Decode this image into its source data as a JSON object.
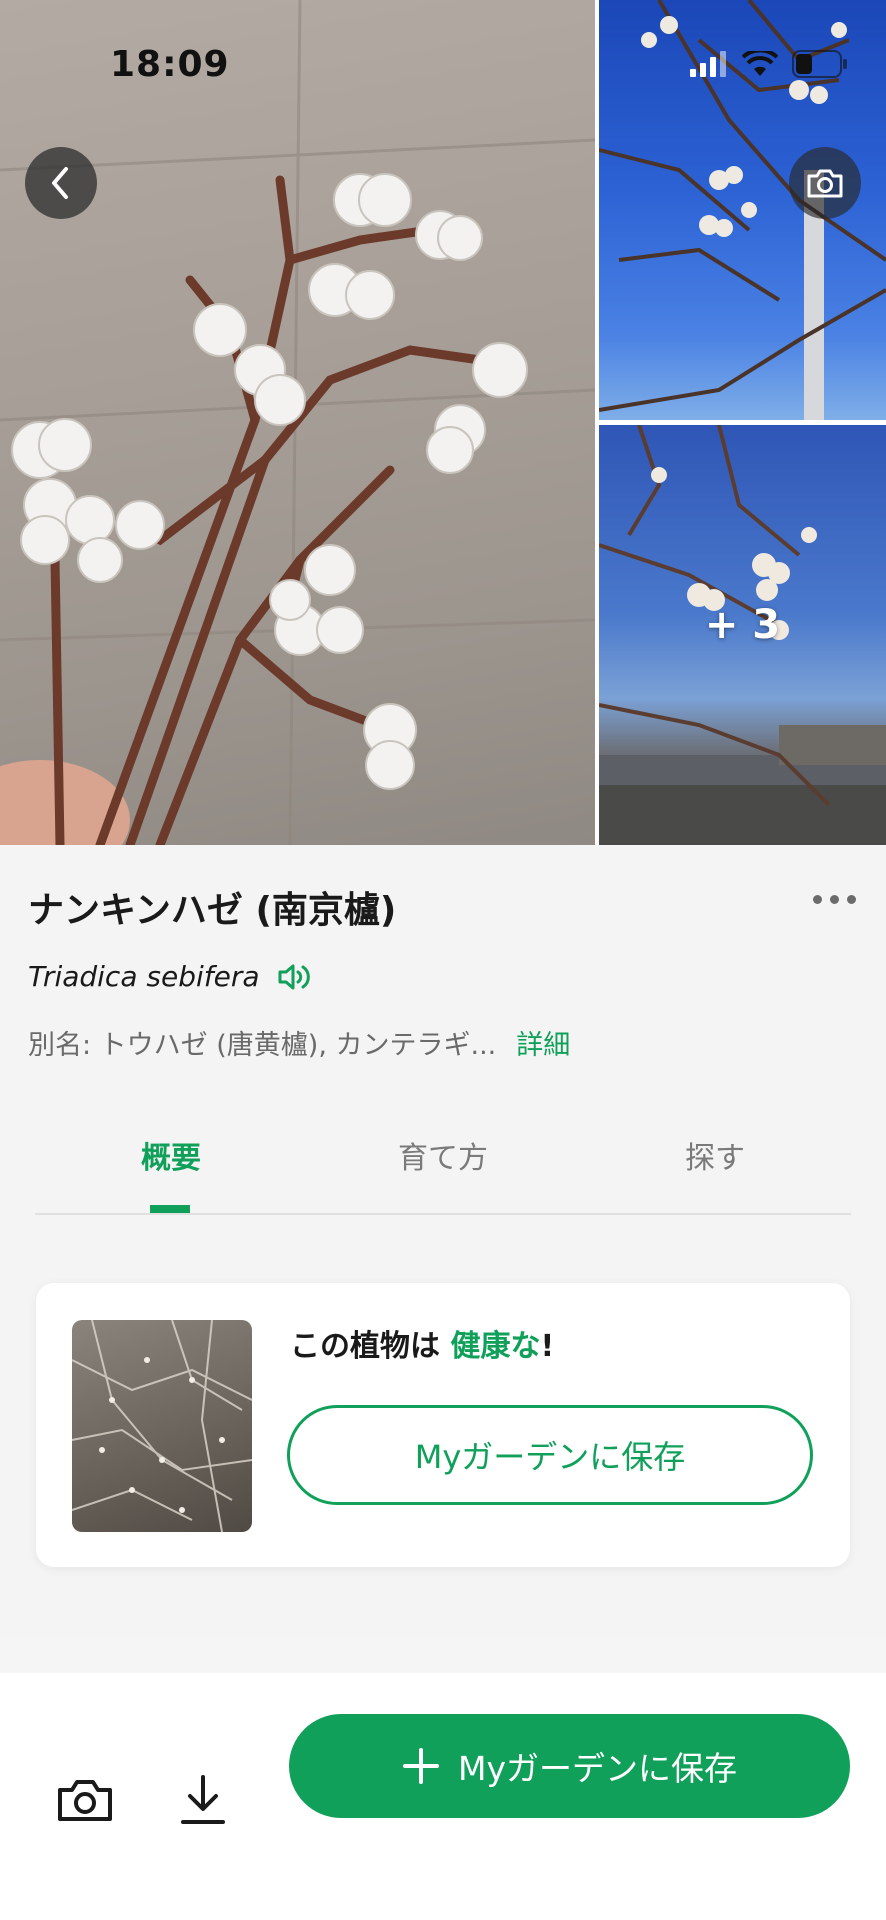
{
  "status_bar": {
    "time": "18:09"
  },
  "gallery": {
    "more_count": "+ 3",
    "icons": {
      "back": "chevron-left-icon",
      "camera": "camera-icon"
    }
  },
  "plant": {
    "name": "ナンキンハゼ (南京櫨)",
    "scientific_name": "Triadica sebifera",
    "alias": "別名: トウハゼ (唐黄櫨), カンテラギ...",
    "detail_link": "詳細"
  },
  "tabs": [
    {
      "label": "概要",
      "active": true
    },
    {
      "label": "育て方",
      "active": false
    },
    {
      "label": "探す",
      "active": false
    }
  ],
  "health_card": {
    "status_prefix": "この植物は ",
    "status_value": "健康な",
    "status_suffix": "!",
    "save_button": "Myガーデンに保存"
  },
  "bottom_bar": {
    "primary_button": "Myガーデンに保存",
    "icons": [
      "camera-icon",
      "download-icon",
      "plus-icon"
    ]
  },
  "colors": {
    "accent": "#10a05a",
    "text_primary": "#1a1a1a",
    "text_secondary": "#6a6a6a",
    "background": "#f4f4f4"
  }
}
